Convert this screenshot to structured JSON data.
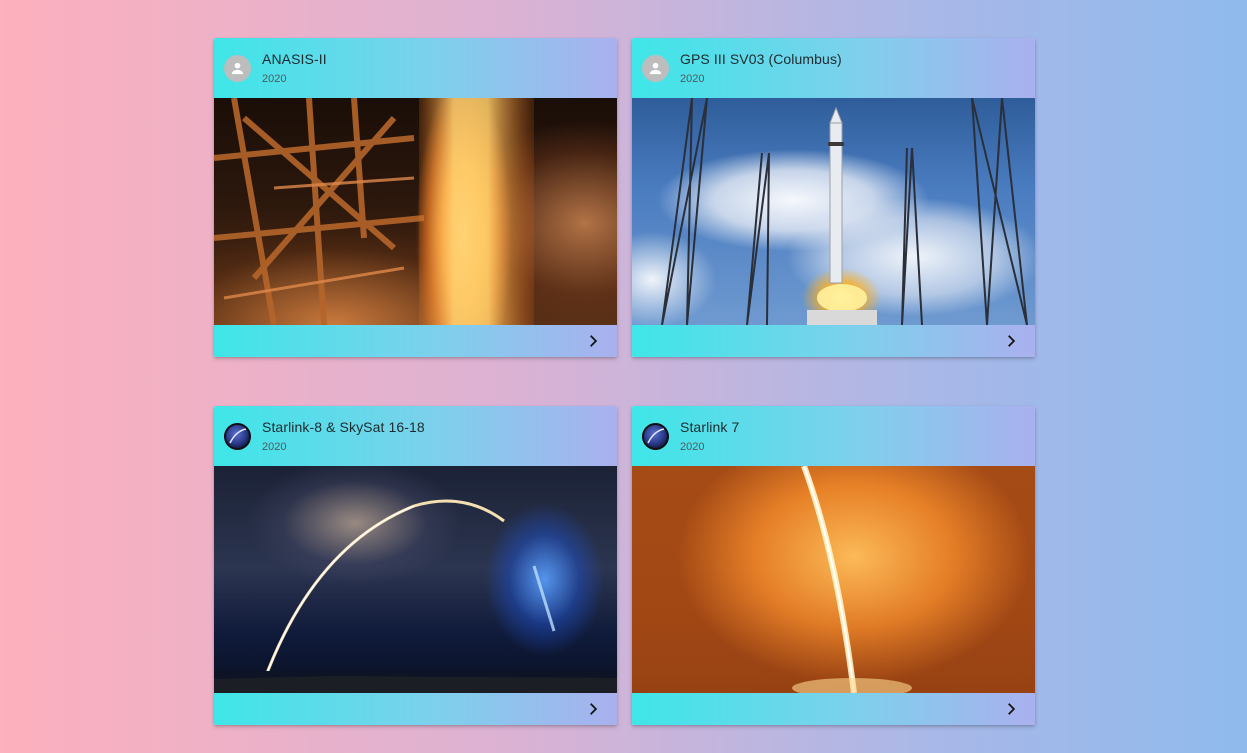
{
  "cards": [
    {
      "title": "ANASIS-II",
      "year": "2020",
      "avatar": "person-icon",
      "image": "engine-fire-launch-photo"
    },
    {
      "title": "GPS III SV03 (Columbus)",
      "year": "2020",
      "avatar": "person-icon",
      "image": "rocket-on-pad-photo"
    },
    {
      "title": "Starlink-8 & SkySat 16-18",
      "year": "2020",
      "avatar": "mission-patch-icon",
      "image": "night-launch-arc-photo"
    },
    {
      "title": "Starlink 7",
      "year": "2020",
      "avatar": "mission-patch-icon",
      "image": "orange-launch-streak-photo"
    }
  ],
  "colors": {
    "header_gradient_start": "#3ee6e8",
    "header_gradient_end": "#aab0ee",
    "background_left": "#fdb0bd",
    "background_right": "#8fbaec"
  }
}
